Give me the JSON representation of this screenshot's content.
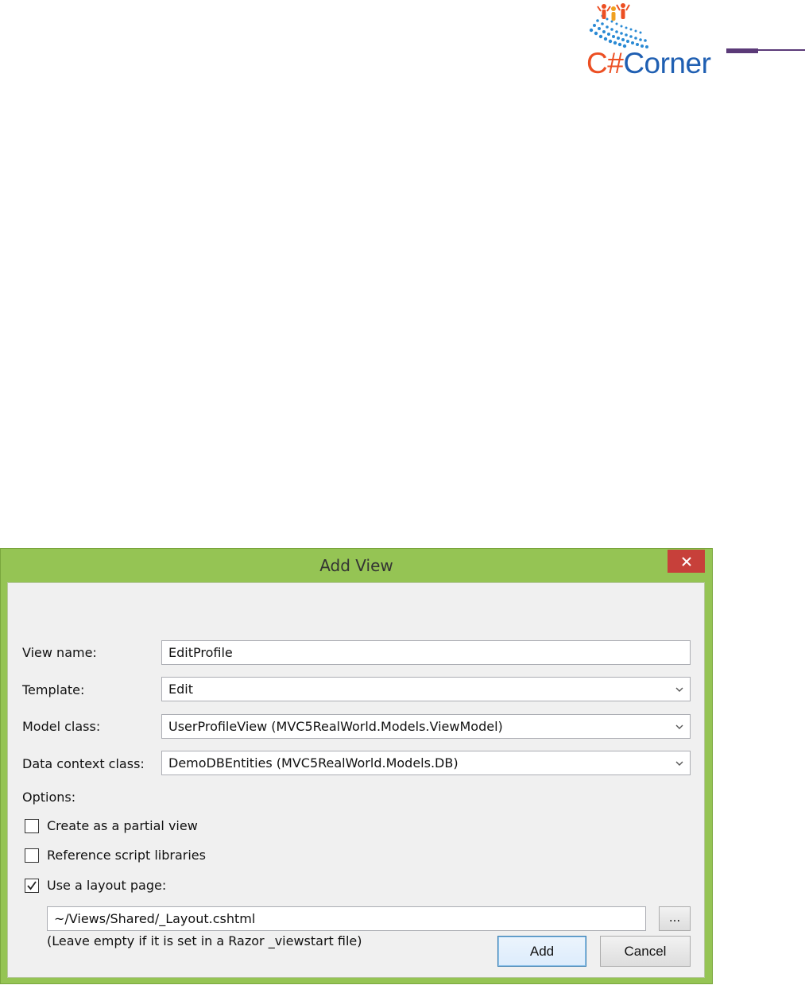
{
  "logo": {
    "text_part1": "C#",
    "text_part2": "Corner"
  },
  "dialog": {
    "title": "Add View",
    "close_glyph": "close-icon",
    "fields": {
      "view_name_label": "View name:",
      "view_name_value": "EditProfile",
      "template_label": "Template:",
      "template_value": "Edit",
      "model_class_label": "Model class:",
      "model_class_value": "UserProfileView (MVC5RealWorld.Models.ViewModel)",
      "data_context_label": "Data context class:",
      "data_context_value": "DemoDBEntities (MVC5RealWorld.Models.DB)"
    },
    "options": {
      "label": "Options:",
      "partial_view_label": "Create as a partial view",
      "partial_view_checked": false,
      "script_libraries_label": "Reference script libraries",
      "script_libraries_checked": false,
      "layout_page_label": "Use a layout page:",
      "layout_page_checked": true,
      "layout_path_value": "~/Views/Shared/_Layout.cshtml",
      "browse_label": "...",
      "hint": "(Leave empty if it is set in a Razor _viewstart file)"
    },
    "buttons": {
      "add": "Add",
      "cancel": "Cancel"
    }
  },
  "colors": {
    "logo_orange": "#ec4f23",
    "logo_blue": "#1f5fb2",
    "rule_purple": "#5b3a78",
    "window_frame": "#95c454",
    "close_red": "#c7403a"
  }
}
